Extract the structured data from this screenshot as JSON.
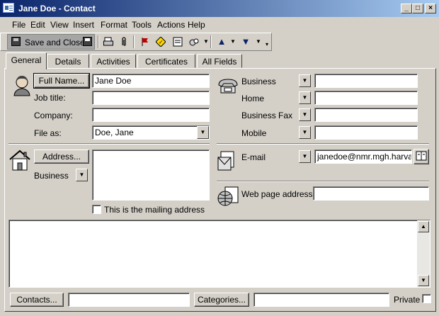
{
  "window": {
    "title": "Jane Doe - Contact",
    "minimize_glyph": "_",
    "maximize_glyph": "□",
    "close_glyph": "×"
  },
  "menu": {
    "file": "File",
    "edit": "Edit",
    "view": "View",
    "insert": "Insert",
    "format": "Format",
    "tools": "Tools",
    "actions": "Actions",
    "help": "Help"
  },
  "toolbar": {
    "save_close_label": "Save and Close",
    "icons": [
      "save-close-icon",
      "floppy-save-icon",
      "print-icon",
      "paperclip-icon",
      "flag-icon",
      "address-card-icon",
      "new-letter-icon",
      "meeting-icon",
      "up-arrow-icon",
      "down-arrow-icon"
    ]
  },
  "tabs": {
    "general": "General",
    "details": "Details",
    "activities": "Activities",
    "certificates": "Certificates",
    "all_fields": "All Fields",
    "active": "General"
  },
  "name_section": {
    "full_name_button": "Full Name...",
    "full_name_value": "Jane Doe",
    "job_title_label": "Job title:",
    "job_title_value": "",
    "company_label": "Company:",
    "company_value": "",
    "file_as_label": "File as:",
    "file_as_value": "Doe, Jane"
  },
  "phones": {
    "business_label": "Business",
    "business_value": "",
    "home_label": "Home",
    "home_value": "",
    "business_fax_label": "Business Fax",
    "business_fax_value": "",
    "mobile_label": "Mobile",
    "mobile_value": ""
  },
  "address": {
    "button": "Address...",
    "type": "Business",
    "value": "",
    "mailing_checkbox_label": "This is the mailing address",
    "mailing_checked": false
  },
  "email": {
    "label": "E-mail",
    "value": "janedoe@nmr.mgh.harvard"
  },
  "web": {
    "label": "Web page address:",
    "value": ""
  },
  "notes": {
    "value": ""
  },
  "footer": {
    "contacts_button": "Contacts...",
    "contacts_value": "",
    "categories_button": "Categories...",
    "categories_value": "",
    "private_label": "Private",
    "private_checked": false
  },
  "colors": {
    "titlebar_start": "#0a246a",
    "titlebar_end": "#a6caf0",
    "face": "#d4d0c8"
  }
}
